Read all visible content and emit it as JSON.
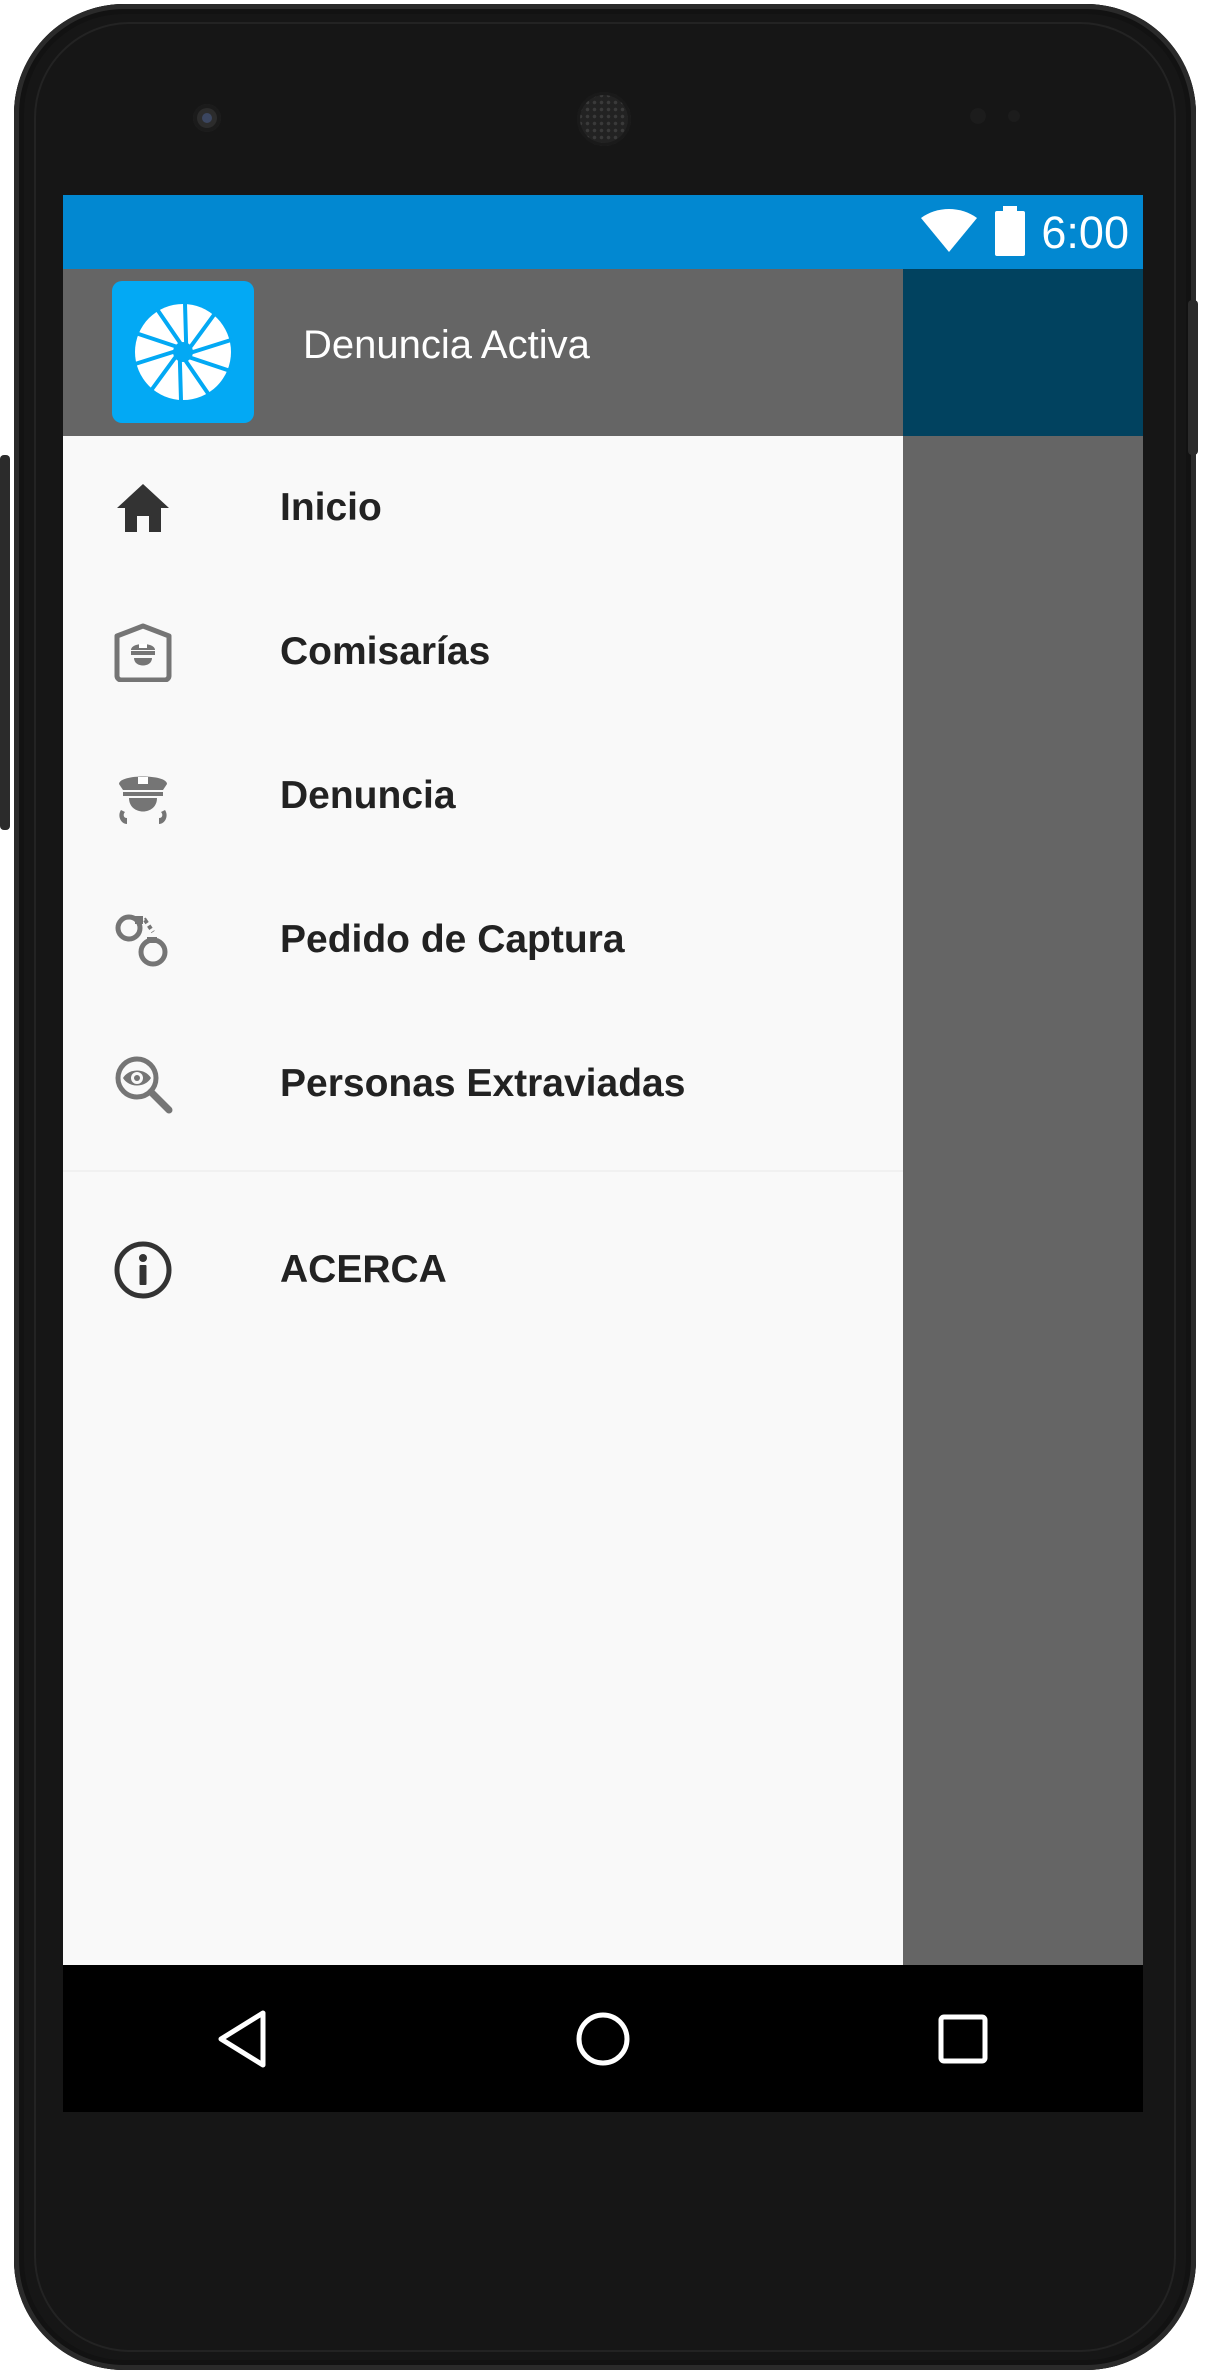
{
  "status_bar": {
    "time": "6:00",
    "icons": [
      "wifi-icon",
      "battery-icon"
    ],
    "color": "#0288d1"
  },
  "drawer": {
    "header": {
      "title": "Denuncia Activa",
      "logo_icon": "aperture-logo-icon",
      "logo_color": "#03a9f4",
      "background": "#656565"
    },
    "items": [
      {
        "label": "Inicio",
        "icon": "home-icon"
      },
      {
        "label": "Comisarías",
        "icon": "police-station-icon"
      },
      {
        "label": "Denuncia",
        "icon": "police-officer-icon"
      },
      {
        "label": "Pedido de Captura",
        "icon": "handcuffs-icon"
      },
      {
        "label": "Personas Extraviadas",
        "icon": "search-eye-icon"
      }
    ],
    "secondary_items": [
      {
        "label": "ACERCA",
        "icon": "info-icon"
      }
    ]
  },
  "navigation_bar": {
    "buttons": [
      "back-icon",
      "home-circle-icon",
      "recents-icon"
    ]
  },
  "colors": {
    "accent_dark": "#01425f",
    "scrim": "#656565",
    "drawer_background": "#f9f9f9"
  }
}
